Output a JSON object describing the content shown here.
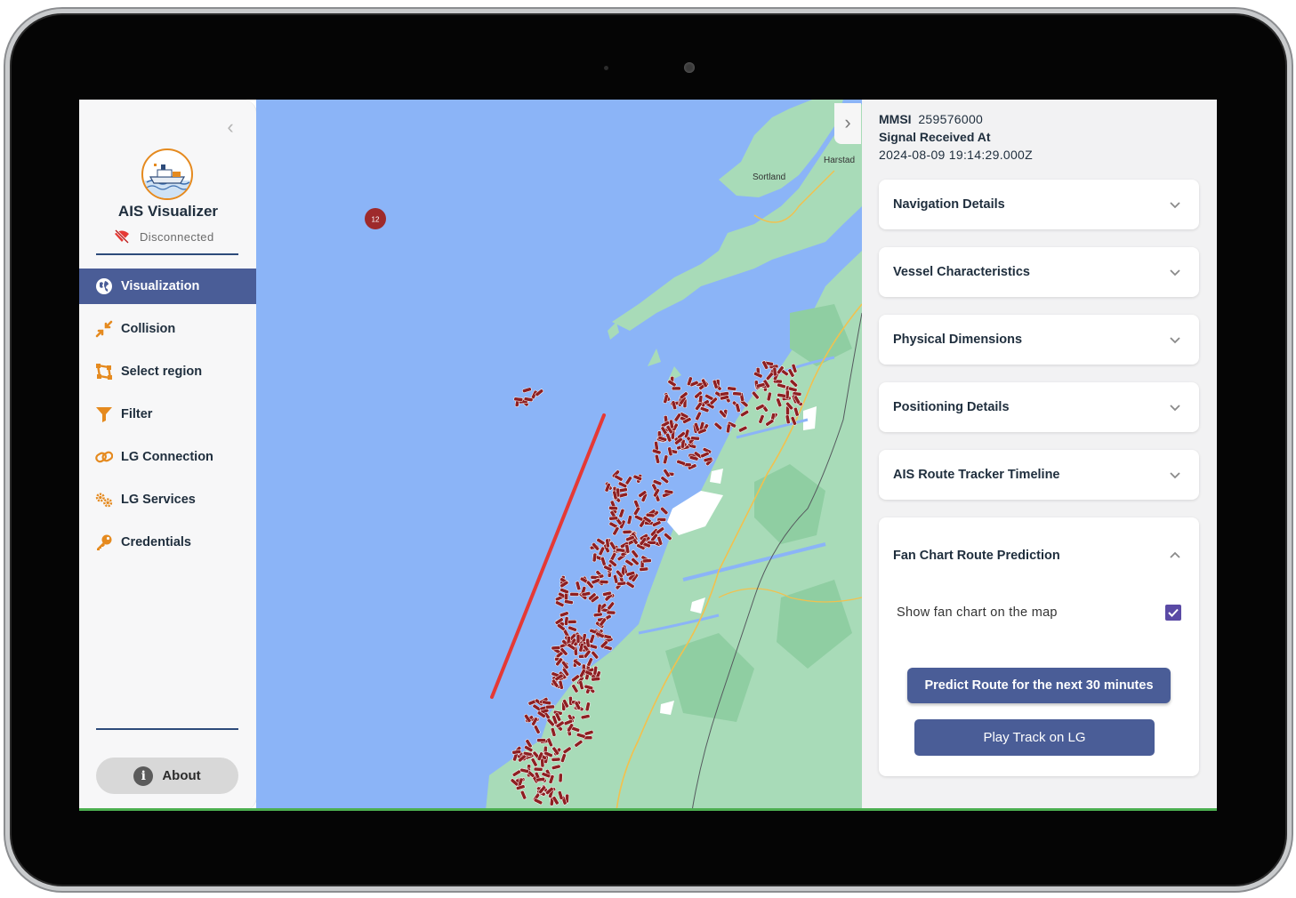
{
  "app": {
    "title": "AIS Visualizer",
    "status": "Disconnected"
  },
  "nav": {
    "items": [
      {
        "label": "Visualization",
        "icon": "globe-icon",
        "active": true
      },
      {
        "label": "Collision",
        "icon": "collision-arrows-icon",
        "active": false
      },
      {
        "label": "Select region",
        "icon": "select-region-icon",
        "active": false
      },
      {
        "label": "Filter",
        "icon": "funnel-icon",
        "active": false
      },
      {
        "label": "LG Connection",
        "icon": "link-icon",
        "active": false
      },
      {
        "label": "LG Services",
        "icon": "gears-icon",
        "active": false
      },
      {
        "label": "Credentials",
        "icon": "key-icon",
        "active": false
      }
    ],
    "about_label": "About"
  },
  "map": {
    "labels": {
      "sortland": "Sortland",
      "harstad": "Harstad",
      "cluster_count": "12"
    }
  },
  "vessel": {
    "mmsi_label": "MMSI",
    "mmsi_value": "259576000",
    "signal_label": "Signal Received At",
    "signal_value": "2024-08-09 19:14:29.000Z"
  },
  "sections": [
    {
      "title": "Navigation Details",
      "expanded": false
    },
    {
      "title": "Vessel Characteristics",
      "expanded": false
    },
    {
      "title": "Physical Dimensions",
      "expanded": false
    },
    {
      "title": "Positioning Details",
      "expanded": false
    },
    {
      "title": "AIS Route Tracker Timeline",
      "expanded": false
    },
    {
      "title": "Fan Chart Route Prediction",
      "expanded": true
    }
  ],
  "fan_chart": {
    "checkbox_label": "Show fan chart on the map",
    "checked": true,
    "predict_label": "Predict Route for the next 30 minutes",
    "play_label": "Play Track on LG"
  },
  "colors": {
    "accent": "#4a5d97",
    "sea": "#8bb4f7",
    "land": "#a8dbb8",
    "vessel": "#8e1f22",
    "route": "#e53935",
    "orange": "#e58a1f"
  }
}
